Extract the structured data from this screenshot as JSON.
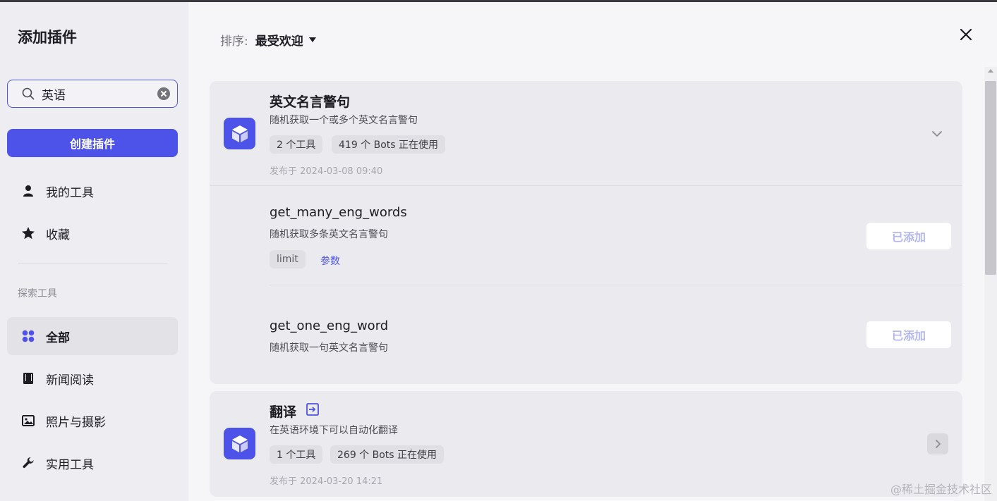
{
  "sidebar": {
    "title": "添加插件",
    "search": {
      "value": "英语",
      "placeholder": ""
    },
    "create_label": "创建插件",
    "my_tools": "我的工具",
    "favorites": "收藏",
    "section_label": "探索工具",
    "categories": [
      {
        "label": "全部",
        "icon": "grid-icon",
        "active": true
      },
      {
        "label": "新闻阅读",
        "icon": "book-icon"
      },
      {
        "label": "照片与摄影",
        "icon": "image-icon"
      },
      {
        "label": "实用工具",
        "icon": "wrench-icon"
      }
    ]
  },
  "main": {
    "sort": {
      "label": "排序:",
      "value": "最受欢迎"
    },
    "plugins": [
      {
        "name": "英文名言警句",
        "desc": "随机获取一个或多个英文名言警句",
        "tools_count": "2 个工具",
        "bots_usage": "419 个 Bots 正在使用",
        "published": "发布于 2024-03-08 09:40",
        "tools": [
          {
            "name": "get_many_eng_words",
            "desc": "随机获取多条英文名言警句",
            "param_tag": "limit",
            "param_link": "参数",
            "button": "已添加"
          },
          {
            "name": "get_one_eng_word",
            "desc": "随机获取一句英文名言警句",
            "button": "已添加"
          }
        ]
      },
      {
        "name": "翻译",
        "desc": "在英语环境下可以自动化翻译",
        "tools_count": "1 个工具",
        "bots_usage": "269 个 Bots 正在使用",
        "published": "发布于 2024-03-20 14:21"
      }
    ]
  },
  "watermark": "@稀土掘金技术社区",
  "colors": {
    "accent": "#4d53e8",
    "sidebar_bg": "#eeeef2",
    "card_bg": "#ebebef"
  }
}
